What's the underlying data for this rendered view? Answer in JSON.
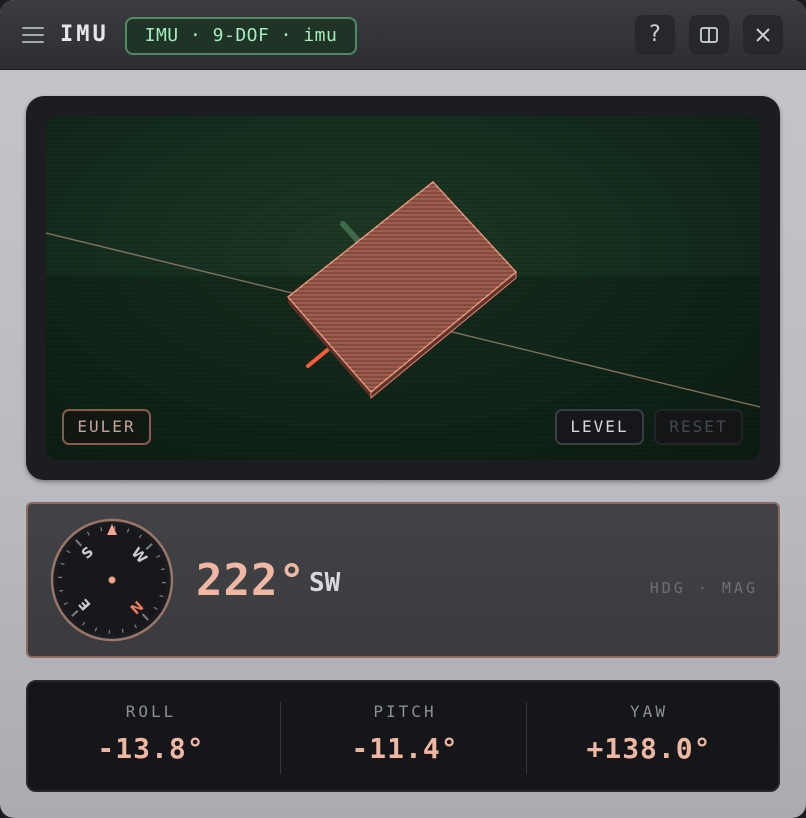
{
  "titlebar": {
    "menu_icon": "hamburger-icon",
    "title": "IMU",
    "device_badge": "IMU · 9-DOF · imu",
    "help_label": "?",
    "split_icon": "split-view-icon",
    "close_icon": "close-icon"
  },
  "viewport": {
    "euler_label": "EULER",
    "level_label": "LEVEL",
    "reset_label": "RESET"
  },
  "heading": {
    "value": "222°",
    "cardinal": "SW",
    "mode": "HDG · MAG",
    "degrees": 222,
    "compass_letters": {
      "n": "N",
      "e": "E",
      "s": "S",
      "w": "W"
    }
  },
  "angles": {
    "roll": {
      "label": "ROLL",
      "value": "-13.8°"
    },
    "pitch": {
      "label": "PITCH",
      "value": "-11.4°"
    },
    "yaw": {
      "label": "YAW",
      "value": "+138.0°"
    }
  },
  "colors": {
    "accent": "#f0b8a3",
    "badge_text": "#a6ecbc",
    "badge_border": "#4f8a63",
    "board": "#e0826b"
  }
}
